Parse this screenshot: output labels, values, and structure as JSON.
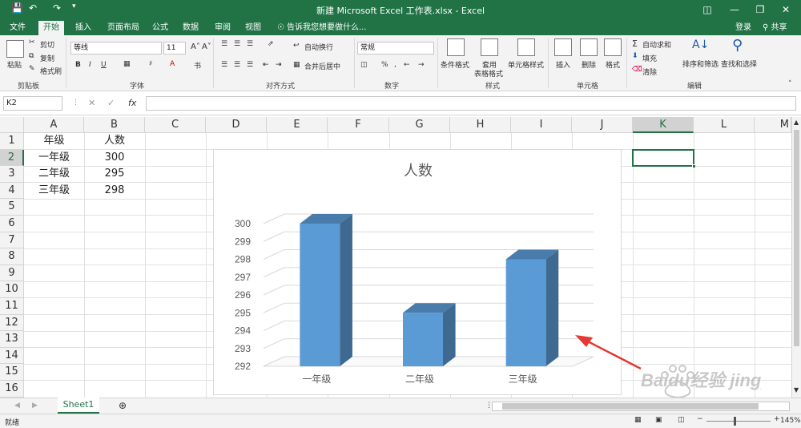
{
  "app": {
    "title": "新建 Microsoft Excel 工作表.xlsx - Excel",
    "login": "登录",
    "share": "共享"
  },
  "tabs": [
    "文件",
    "开始",
    "插入",
    "页面布局",
    "公式",
    "数据",
    "审阅",
    "视图"
  ],
  "tell_me": "告诉我您想要做什么...",
  "ribbon": {
    "clipboard": {
      "paste": "粘贴",
      "cut": "剪切",
      "copy": "复制",
      "format_painter": "格式刷",
      "label": "剪贴板"
    },
    "font": {
      "name": "等线",
      "size": "11",
      "label": "字体",
      "bold": "B",
      "italic": "I",
      "underline": "U"
    },
    "alignment": {
      "wrap": "自动换行",
      "merge": "合并后居中",
      "label": "对齐方式"
    },
    "number": {
      "format": "常规",
      "label": "数字"
    },
    "styles": {
      "conditional": "条件格式",
      "table": "套用",
      "table2": "表格格式",
      "cell": "单元格样式",
      "label": "样式"
    },
    "cells": {
      "insert": "插入",
      "delete": "删除",
      "format": "格式",
      "label": "单元格"
    },
    "editing": {
      "autosum": "自动求和",
      "fill": "填充",
      "clear": "清除",
      "sort": "排序和筛选",
      "find": "查找和选择",
      "label": "编辑"
    }
  },
  "formula_bar": {
    "name_box": "K2",
    "fx": "fx",
    "value": ""
  },
  "columns": [
    "A",
    "B",
    "C",
    "D",
    "E",
    "F",
    "G",
    "H",
    "I",
    "J",
    "K",
    "L",
    "M"
  ],
  "rows": [
    "1",
    "2",
    "3",
    "4",
    "5",
    "6",
    "7",
    "8",
    "9",
    "10",
    "11",
    "12",
    "13",
    "14",
    "15",
    "16"
  ],
  "table": {
    "header": [
      "年级",
      "人数"
    ],
    "rows": [
      [
        "一年级",
        "300"
      ],
      [
        "二年级",
        "295"
      ],
      [
        "三年级",
        "298"
      ]
    ]
  },
  "chart_data": {
    "type": "bar",
    "title": "人数",
    "categories": [
      "一年级",
      "二年级",
      "三年级"
    ],
    "values": [
      300,
      295,
      298
    ],
    "ylim": [
      292,
      300
    ],
    "yticks": [
      "292",
      "293",
      "294",
      "295",
      "296",
      "297",
      "298",
      "299",
      "300"
    ],
    "xlabel": "",
    "ylabel": "",
    "bar_color": "#5b9bd5",
    "grid": true,
    "legend": "none"
  },
  "sheet": {
    "name": "Sheet1"
  },
  "status": {
    "ready": "就绪",
    "zoom": "145%"
  },
  "colors": {
    "accent": "#217346",
    "bar": "#5b9bd5",
    "arrow": "#e53935"
  },
  "watermark": "Baidu经验 jingyan.baidu.com"
}
